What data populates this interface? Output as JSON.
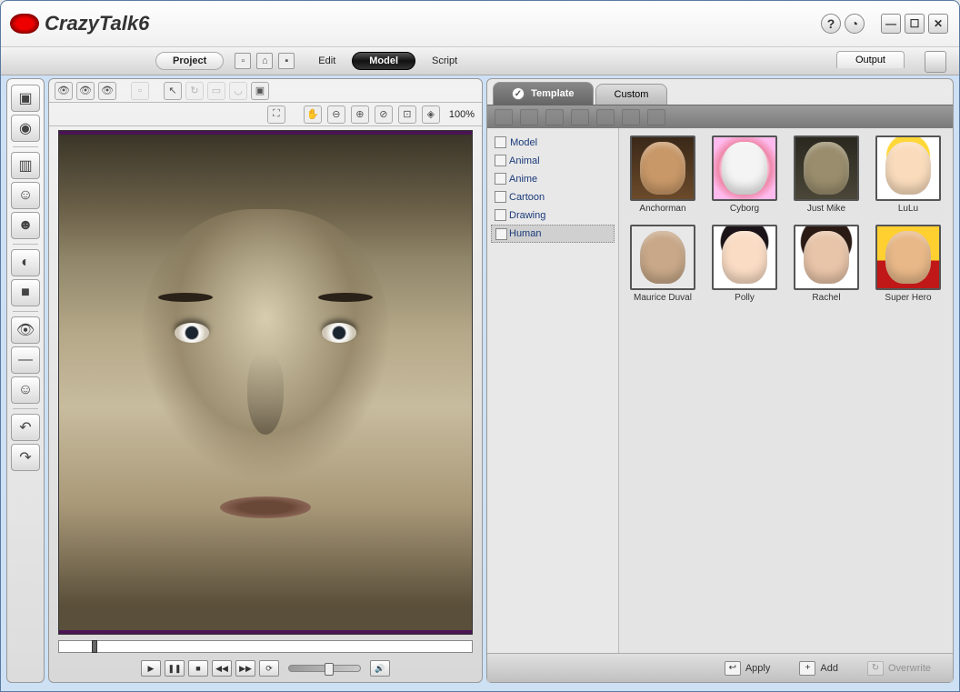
{
  "app": {
    "title": "CrazyTalk6"
  },
  "menu": {
    "project": "Project",
    "edit": "Edit",
    "model": "Model",
    "script": "Script",
    "output": "Output"
  },
  "viewport": {
    "zoom": "100%"
  },
  "browser": {
    "tabs": {
      "template": "Template",
      "custom": "Custom"
    },
    "tree": {
      "root": "Model",
      "items": [
        "Animal",
        "Anime",
        "Cartoon",
        "Drawing",
        "Human"
      ],
      "selected": "Human"
    },
    "models": [
      {
        "name": "Anchorman",
        "bg": "linear-gradient(#3a2818,#6b4a2a)",
        "face": "#c89868"
      },
      {
        "name": "Cyborg",
        "bg": "radial-gradient(circle,#fff 45%,#e8a 60%,#fbe 80%)",
        "face": "#f4f4f4"
      },
      {
        "name": "Just Mike",
        "bg": "linear-gradient(#2a281f,#4a4638)",
        "face": "#9a8d6d"
      },
      {
        "name": "LuLu",
        "bg": "radial-gradient(circle at 50% 30%,#ffd838 40%,#fff 42%)",
        "face": "#fadcbc"
      },
      {
        "name": "Maurice Duval",
        "bg": "#e8e8e8",
        "face": "#c8a888"
      },
      {
        "name": "Polly",
        "bg": "radial-gradient(circle at 50% 25%,#1a1418 42%,#fff 44%)",
        "face": "#fadcc4"
      },
      {
        "name": "Rachel",
        "bg": "radial-gradient(circle at 50% 25%,#2a1a14 45%,#fff 47%)",
        "face": "#e8c4a8"
      },
      {
        "name": "Super Hero",
        "bg": "linear-gradient(#ffd030 55%,#c01818 55%)",
        "face": "#e8b888"
      }
    ],
    "footer": {
      "apply": "Apply",
      "add": "Add",
      "overwrite": "Overwrite"
    }
  }
}
